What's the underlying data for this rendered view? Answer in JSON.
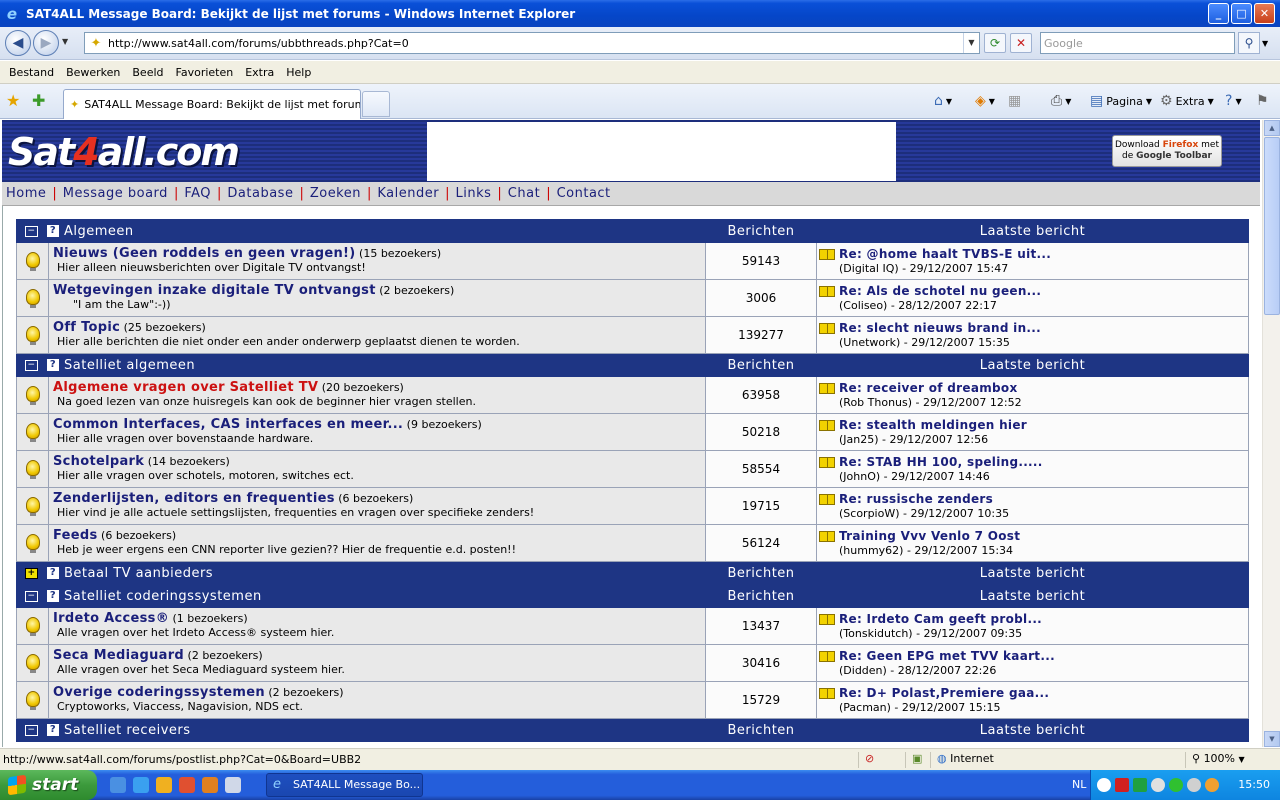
{
  "window": {
    "title": "SAT4ALL Message Board: Bekijkt de lijst met forums - Windows Internet Explorer",
    "minimize": "_",
    "maximize": "□",
    "close": "✕"
  },
  "address": {
    "url": "http://www.sat4all.com/forums/ubbthreads.php?Cat=0",
    "search_placeholder": "Google"
  },
  "menu": [
    "Bestand",
    "Bewerken",
    "Beeld",
    "Favorieten",
    "Extra",
    "Help"
  ],
  "tab": {
    "label": "SAT4ALL Message Board: Bekijkt de lijst met forums"
  },
  "commands": {
    "pagina": "Pagina",
    "extra": "Extra"
  },
  "site": {
    "logo_pre": "Sat",
    "logo_four": "4",
    "logo_post": "all.com",
    "firefox_line1": "Download ",
    "firefox_brand": "Firefox",
    "firefox_mid": " met",
    "firefox_line2_pre": "de ",
    "firefox_line2_brand": "Google Toolbar",
    "nav": [
      "Home",
      "Message board",
      "FAQ",
      "Database",
      "Zoeken",
      "Kalender",
      "Links",
      "Chat",
      "Contact"
    ]
  },
  "headers": {
    "posts": "Berichten",
    "last_post": "Laatste bericht"
  },
  "categories": [
    {
      "name": "Algemeen",
      "toggle": "−",
      "forums": [
        {
          "name": "Nieuws (Geen roddels en geen vragen!)",
          "visitors": "(15 bezoekers)",
          "desc": "Hier alleen nieuwsberichten over Digitale TV ontvangst!",
          "posts": "59143",
          "last_title": "Re: @home haalt TVBS-E uit...",
          "last_meta": "(Digital IQ) - 29/12/2007 15:47"
        },
        {
          "name": "Wetgevingen inzake digitale TV ontvangst",
          "visitors": "(2 bezoekers)",
          "desc": "\"I am the Law\":-))",
          "posts": "3006",
          "last_title": "Re: Als de schotel nu geen...",
          "last_meta": "(Coliseo) - 28/12/2007 22:17"
        },
        {
          "name": "Off Topic",
          "visitors": "(25 bezoekers)",
          "desc": "Hier alle berichten die niet onder een ander onderwerp geplaatst dienen te worden.",
          "posts": "139277",
          "last_title": "Re: slecht nieuws brand in...",
          "last_meta": "(Unetwork) - 29/12/2007 15:35"
        }
      ]
    },
    {
      "name": "Satelliet algemeen",
      "toggle": "−",
      "forums": [
        {
          "name": "Algemene vragen over Satelliet TV",
          "visitors": "(20 bezoekers)",
          "desc": "Na goed lezen van onze huisregels kan ook de beginner hier vragen stellen.",
          "posts": "63958",
          "last_title": "Re: receiver of dreambox",
          "last_meta": "(Rob Thonus) - 29/12/2007 12:52"
        },
        {
          "name": "Common Interfaces, CAS interfaces en meer...",
          "visitors": "(9 bezoekers)",
          "desc": "Hier alle vragen over bovenstaande hardware.",
          "posts": "50218",
          "last_title": "Re: stealth meldingen hier",
          "last_meta": "(Jan25) - 29/12/2007 12:56"
        },
        {
          "name": "Schotelpark",
          "visitors": "(14 bezoekers)",
          "desc": "Hier alle vragen over schotels, motoren, switches ect.",
          "posts": "58554",
          "last_title": "Re: STAB HH 100, speling.....",
          "last_meta": "(JohnO) - 29/12/2007 14:46"
        },
        {
          "name": "Zenderlijsten, editors en frequenties",
          "visitors": "(6 bezoekers)",
          "desc": "Hier vind je alle actuele settingslijsten, frequenties en vragen over specifieke zenders!",
          "posts": "19715",
          "last_title": "Re: russische zenders",
          "last_meta": "(ScorpioW) - 29/12/2007 10:35"
        },
        {
          "name": "Feeds",
          "visitors": "(6 bezoekers)",
          "desc": "Heb je weer ergens een CNN reporter live gezien?? Hier de frequentie e.d. posten!!",
          "posts": "56124",
          "last_title": "Training Vvv Venlo 7 Oost",
          "last_meta": "(hummy62) - 29/12/2007 15:34"
        }
      ]
    },
    {
      "name": "Betaal TV aanbieders",
      "toggle": "+",
      "forums": []
    },
    {
      "name": "Satelliet coderingssystemen",
      "toggle": "−",
      "forums": [
        {
          "name": "Irdeto Access®",
          "visitors": "(1 bezoekers)",
          "desc": "Alle vragen over het Irdeto Access® systeem hier.",
          "posts": "13437",
          "last_title": "Re: Irdeto Cam geeft probl...",
          "last_meta": "(Tonskidutch) - 29/12/2007 09:35"
        },
        {
          "name": "Seca Mediaguard",
          "visitors": "(2 bezoekers)",
          "desc": "Alle vragen over het Seca Mediaguard systeem hier.",
          "posts": "30416",
          "last_title": "Re: Geen EPG met TVV kaart...",
          "last_meta": "(Didden) - 28/12/2007 22:26"
        },
        {
          "name": "Overige coderingssystemen",
          "visitors": "(2 bezoekers)",
          "desc": "Cryptoworks, Viaccess, Nagavision, NDS ect.",
          "posts": "15729",
          "last_title": "Re: D+ Polast,Premiere gaa...",
          "last_meta": "(Pacman) - 29/12/2007 15:15"
        }
      ]
    },
    {
      "name": "Satelliet receivers",
      "toggle": "−",
      "forums": []
    }
  ],
  "status": {
    "text": "http://www.sat4all.com/forums/postlist.php?Cat=0&Board=UBB2",
    "zone": "Internet",
    "zoom": "100%"
  },
  "taskbar": {
    "start": "start",
    "task_label": "SAT4ALL Message Bo...",
    "lang": "NL",
    "clock": "15:50"
  },
  "colors": {
    "category_bg": "#1e3584",
    "link": "#1a1f7a",
    "highlight_link": "#cc1111",
    "nav_separator": "#cc0000"
  }
}
